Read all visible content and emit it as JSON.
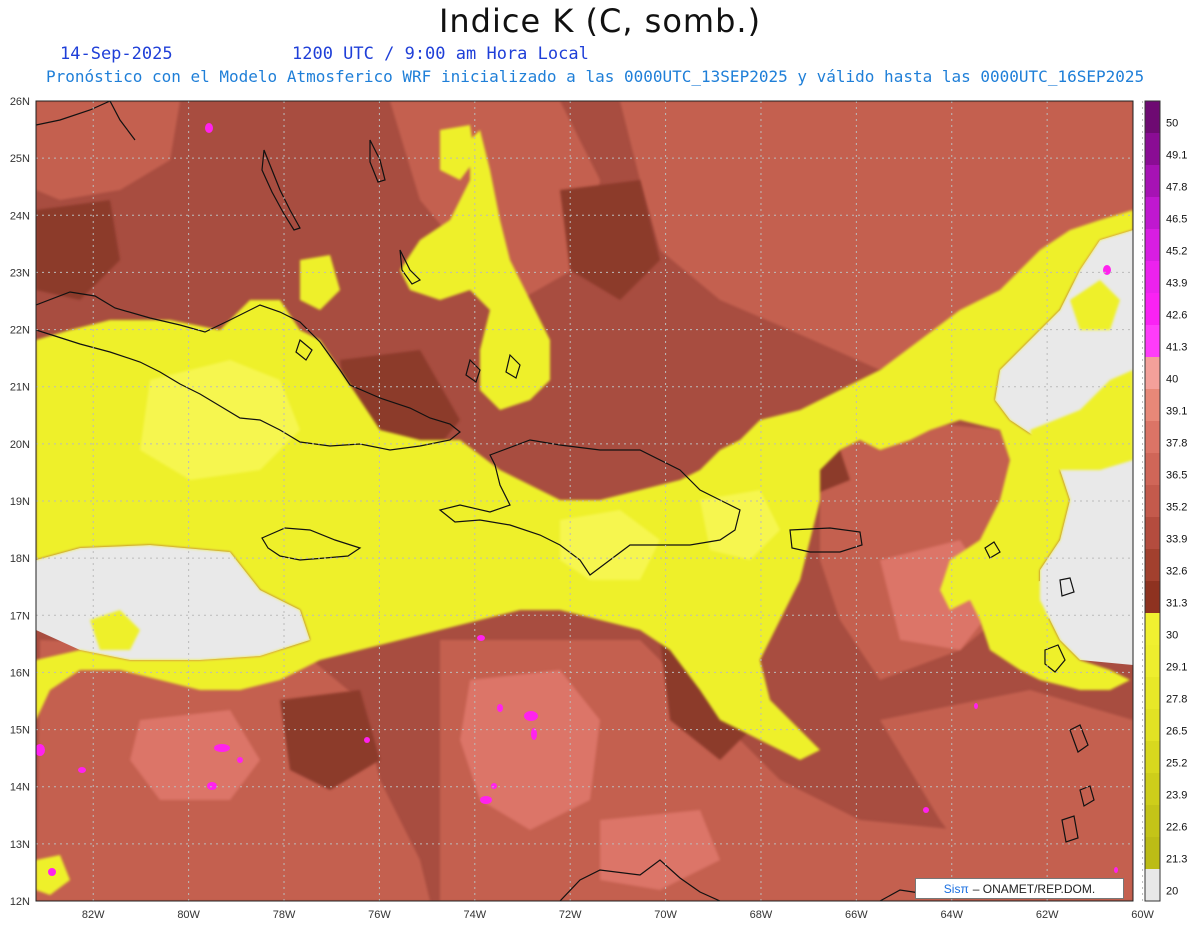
{
  "header": {
    "title": "Indice K (C, somb.)",
    "date": "14-Sep-2025",
    "time": "1200 UTC / 9:00 am Hora Local",
    "subtitle": "Pronóstico con el Modelo Atmosferico WRF inicializado a las 0000UTC_13SEP2025 y válido hasta las  0000UTC_16SEP2025"
  },
  "map": {
    "lat_labels": [
      "26N",
      "25N",
      "24N",
      "23N",
      "22N",
      "21N",
      "20N",
      "19N",
      "18N",
      "17N",
      "16N",
      "15N",
      "14N",
      "13N",
      "12N"
    ],
    "lon_labels": [
      "82W",
      "80W",
      "78W",
      "76W",
      "74W",
      "72W",
      "70W",
      "68W",
      "66W",
      "64W",
      "62W",
      "60W"
    ],
    "colors": {
      "background_field": "#a84d40",
      "dark_brown": "#8a3a2a",
      "salmon": "#cc6a5a",
      "pink": "#e8877a",
      "yellow": "#eef02a",
      "yellow_light": "#f4f43c",
      "gray": "#e9e9e9",
      "magenta": "#ff1ef0"
    }
  },
  "colorbar": {
    "labels": [
      "50",
      "49.1",
      "47.8",
      "46.5",
      "45.2",
      "43.9",
      "42.6",
      "41.3",
      "40",
      "39.1",
      "37.8",
      "36.5",
      "35.2",
      "33.9",
      "32.6",
      "31.3",
      "30",
      "29.1",
      "27.8",
      "26.5",
      "25.2",
      "23.9",
      "22.6",
      "21.3",
      "20"
    ],
    "colors": [
      "#6e0a72",
      "#8a0c94",
      "#a612b4",
      "#c018d0",
      "#d81ee2",
      "#ec22ee",
      "#fa22f4",
      "#ff3cfa",
      "#f4a09a",
      "#e88878",
      "#dc7466",
      "#d06658",
      "#c45a4c",
      "#b44c3e",
      "#a2402e",
      "#8e3220",
      "#f0f030",
      "#eeee2e",
      "#e8e828",
      "#e2e224",
      "#d8d81e",
      "#cece1a",
      "#c4c418",
      "#bcbc16",
      "#e8e8e8"
    ]
  },
  "credit": {
    "sis": "Sisπ",
    "text": "– ONAMET/REP.DOM."
  }
}
